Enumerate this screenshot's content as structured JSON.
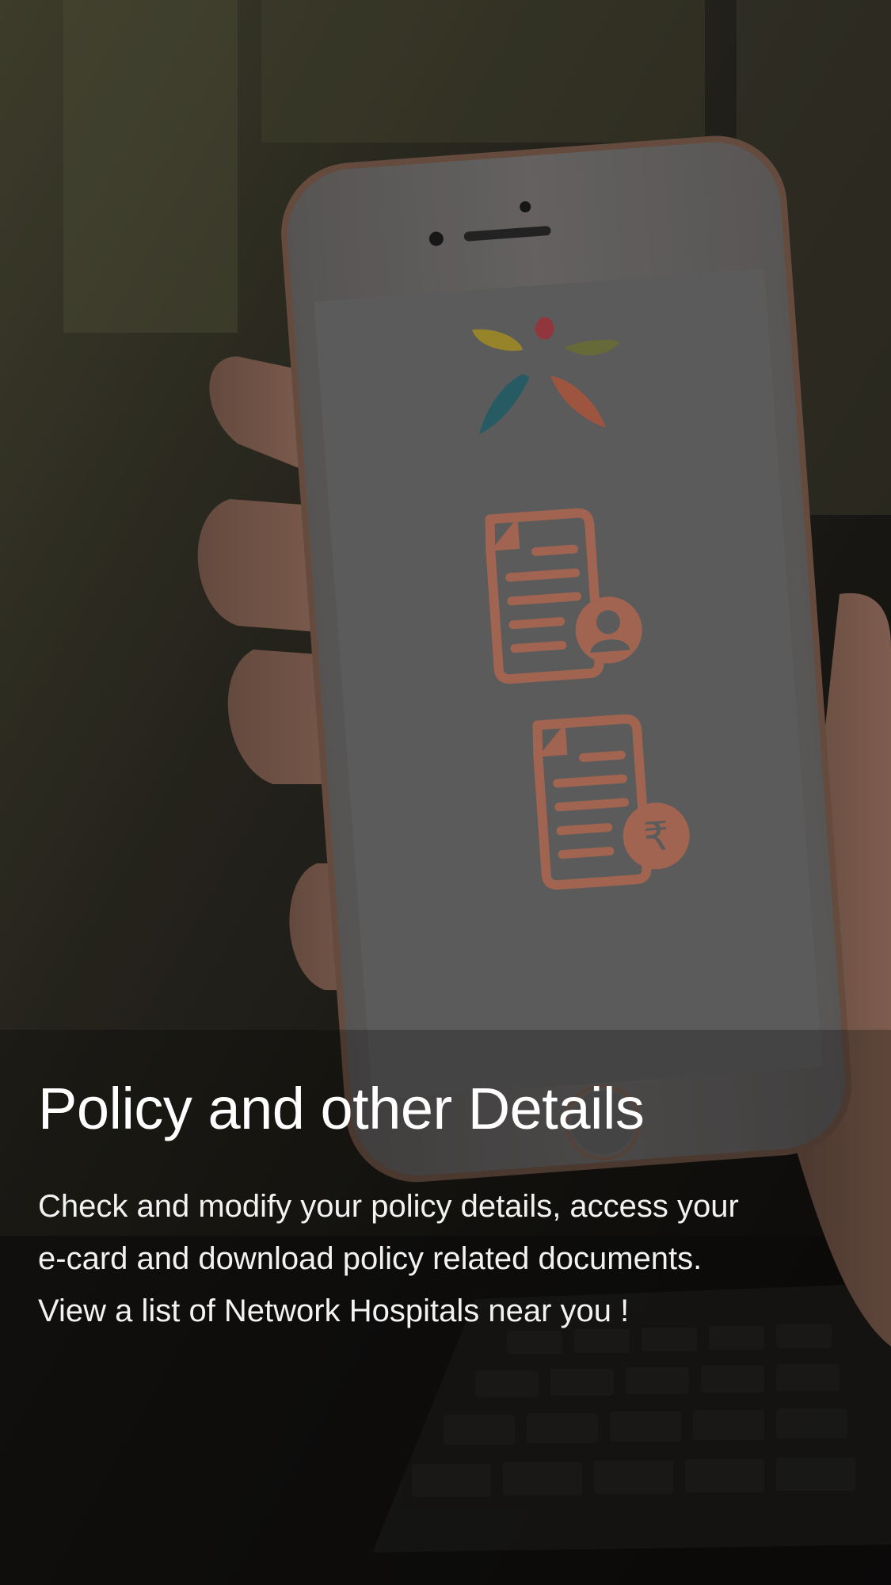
{
  "onboarding": {
    "title": "Policy and other Details",
    "description_lines": [
      "Check and modify your policy details, access your",
      "e-card and download policy related documents.",
      "View a list of Network Hospitals near you !"
    ]
  },
  "illustration": {
    "icons": [
      "brand-logo",
      "policy-document-user-icon",
      "policy-document-rupee-icon"
    ],
    "rupee_symbol": "₹",
    "colors": {
      "logo_red": "#b2434c",
      "logo_yellow": "#b9a234",
      "logo_olive": "#7d8245",
      "logo_teal": "#2f6f7a",
      "logo_orange": "#c0684f",
      "document_orange": "#c47a62",
      "dim_overlay": "#000000"
    }
  }
}
